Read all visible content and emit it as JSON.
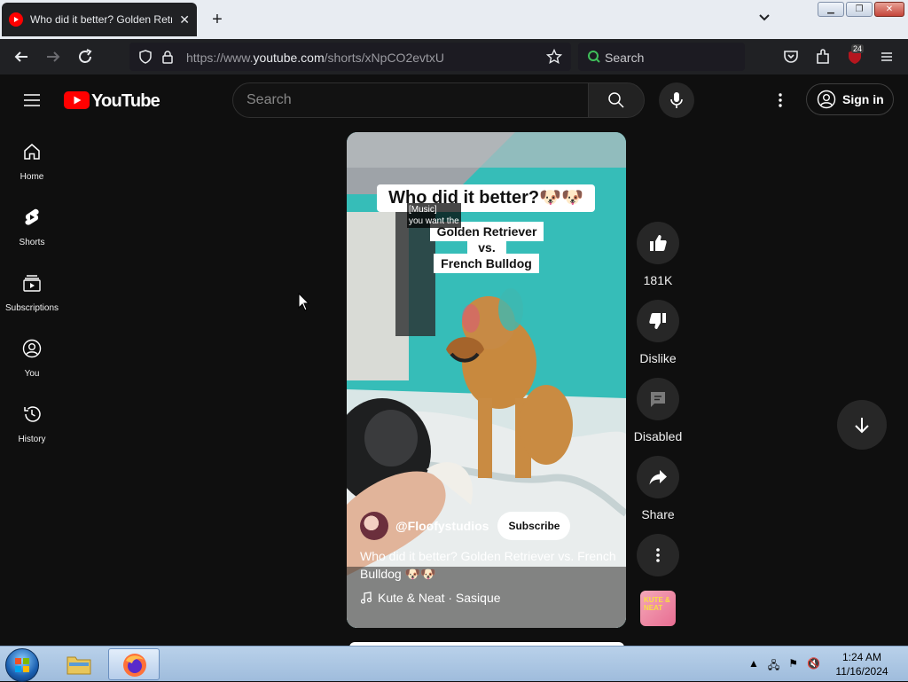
{
  "browser": {
    "tab_title": "Who did it better? Golden Retriever vs. French Bulldog",
    "tab_close": "✕",
    "new_tab": "+",
    "url_prefix": "https://www.",
    "url_domain": "youtube.com",
    "url_path": "/shorts/xNpCO2evtxU",
    "search_label": "Search",
    "extensions_badge": "24"
  },
  "youtube": {
    "logo_text": "YouTube",
    "search_placeholder": "Search",
    "sign_in_label": "Sign in"
  },
  "guide": [
    {
      "label": "Home",
      "icon": "home-icon"
    },
    {
      "label": "Shorts",
      "icon": "shorts-icon"
    },
    {
      "label": "Subscriptions",
      "icon": "subscriptions-icon"
    },
    {
      "label": "You",
      "icon": "you-icon"
    },
    {
      "label": "History",
      "icon": "history-icon"
    }
  ],
  "short": {
    "overlay_title": "Who did it better?🐶🐶",
    "overlay_line1": "Golden Retriever",
    "overlay_line2": "vs.",
    "overlay_line3": "French Bulldog",
    "caption_line1": "[Music]",
    "caption_line2": "you want the",
    "channel": "@Floofystudios",
    "subscribe_label": "Subscribe",
    "description": "Who did it better? Golden Retriever vs. French Bulldog 🐶🐶",
    "music": "Kute & Neat · Sasique"
  },
  "actions": {
    "like_count": "181K",
    "dislike_label": "Dislike",
    "comments_label": "Disabled",
    "share_label": "Share",
    "sound_thumb_text": "KUTE & NEAT"
  },
  "taskbar": {
    "time": "1:24 AM",
    "date": "11/16/2024"
  },
  "colors": {
    "yt_red": "#ff0000",
    "background": "#0f0f0f",
    "teal_backdrop": "#2fb7b4"
  }
}
